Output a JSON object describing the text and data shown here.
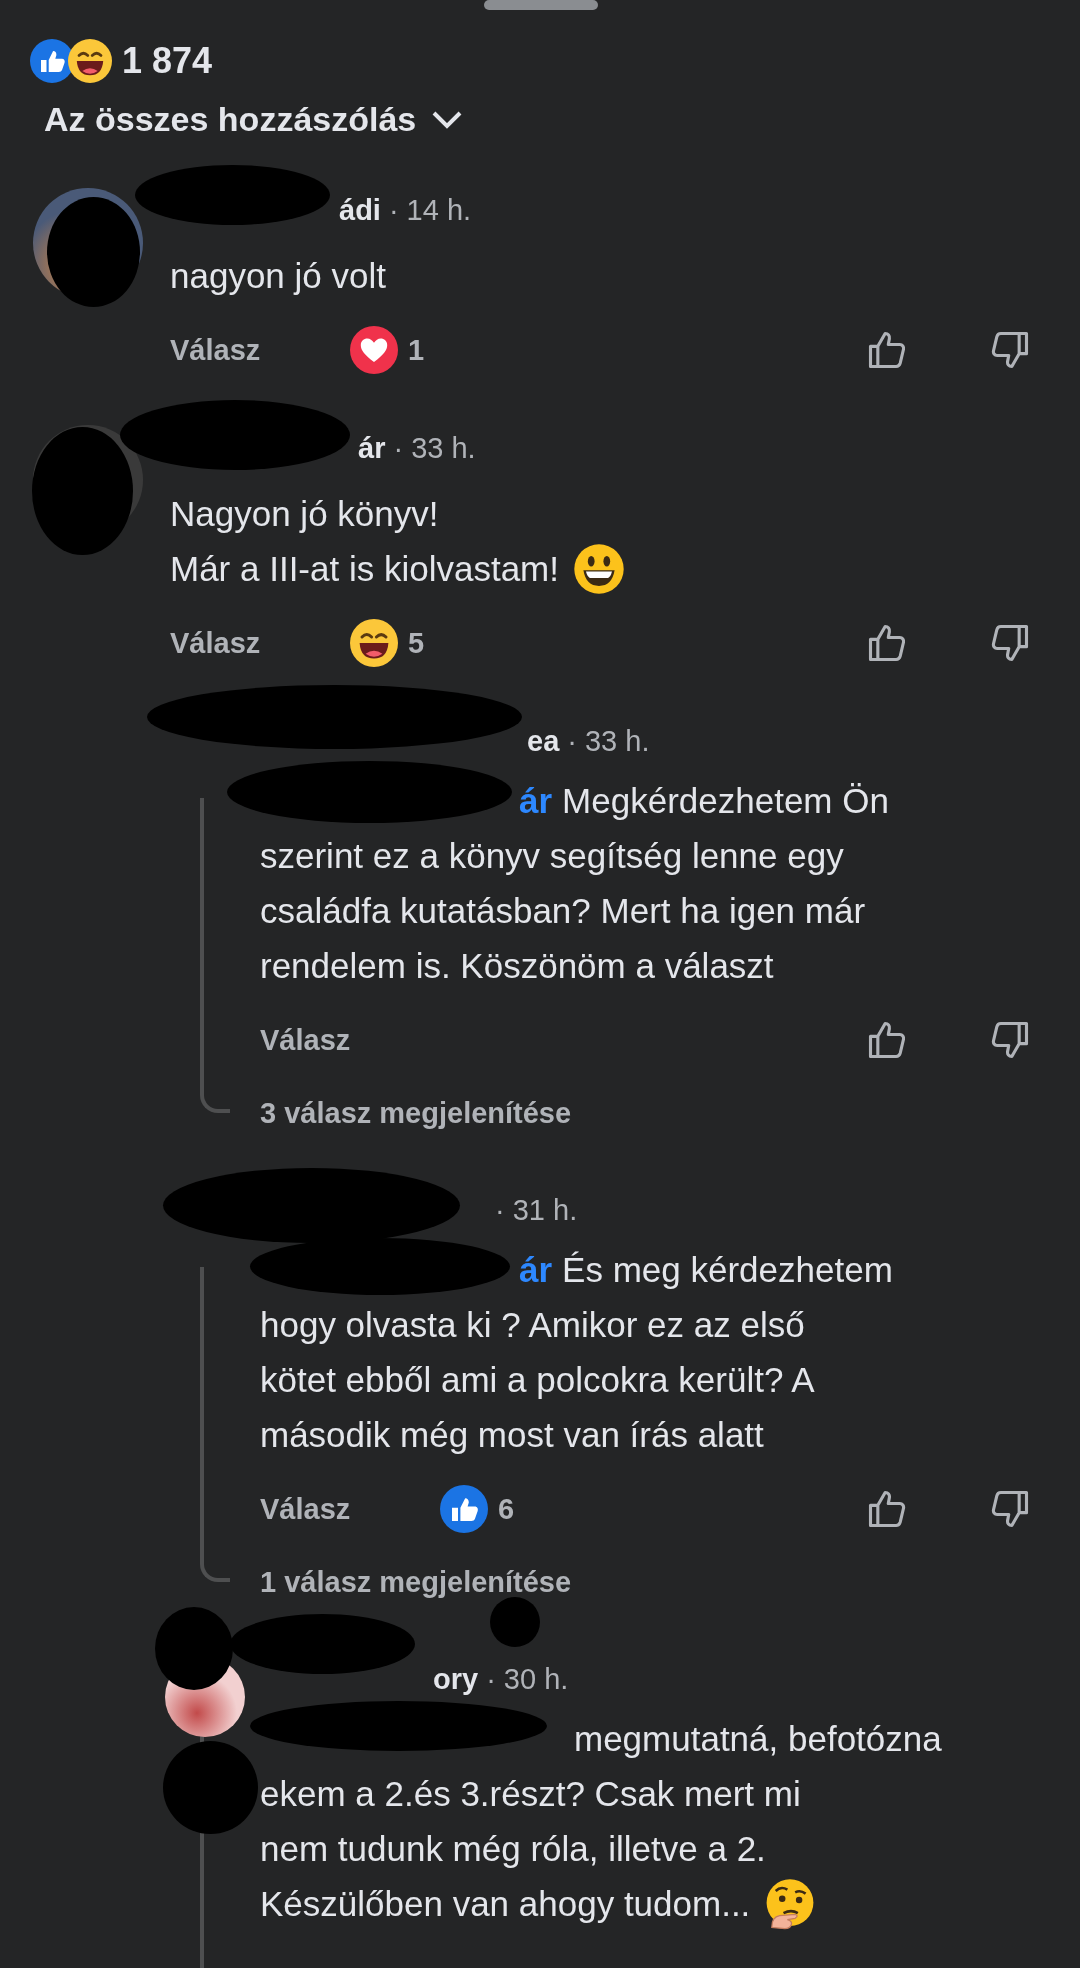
{
  "reactions": {
    "icons": [
      {
        "kind": "like"
      },
      {
        "kind": "haha"
      }
    ],
    "count": "1 874"
  },
  "sort": {
    "label": "Az összes hozzászólás"
  },
  "comments": [
    {
      "kind": "top",
      "name_tail": "ádi",
      "time": "· 14 h.",
      "lines": [
        "nagyon jó volt"
      ],
      "reply_label": "Válasz",
      "reaction": {
        "kind": "love",
        "count": "1"
      }
    },
    {
      "kind": "top",
      "name_tail": "ár",
      "time": "· 33 h.",
      "lines": [
        "Nagyon jó könyv!",
        "Már a III-at is kiolvastam!"
      ],
      "emoji": {
        "kind": "grin"
      },
      "reply_label": "Válasz",
      "reaction": {
        "kind": "haha",
        "count": "5"
      }
    },
    {
      "kind": "reply",
      "name_tail": "ea",
      "time": "· 33 h.",
      "mention": "ár",
      "lines": [
        "Megkérdezhetem Ön",
        "szerint ez a könyv segítség lenne egy",
        "családfa kutatásban? Mert ha igen már",
        "rendelem is. Köszönöm a választ"
      ],
      "reply_label": "Válasz",
      "more_replies": "3 válasz megjelenítése"
    },
    {
      "kind": "reply",
      "time": "· 31 h.",
      "mention": "ár",
      "lines": [
        "És meg kérdezhetem",
        "hogy olvasta ki ? Amikor ez az első",
        "kötet ebből ami a polcokra került? A",
        "második még most van írás alatt"
      ],
      "reply_label": "Válasz",
      "reaction": {
        "kind": "like",
        "count": "6"
      },
      "more_replies": "1 válasz megjelenítése"
    },
    {
      "kind": "reply",
      "name_tail": "ory",
      "time": "· 30 h.",
      "lines": [
        "megmutatná, befotózna",
        "ekem a 2.és 3.részt? Csak mert mi",
        "nem tudunk még róla, illetve a 2.",
        "Készülőben van ahogy tudom..."
      ],
      "emoji": {
        "kind": "think"
      }
    }
  ]
}
